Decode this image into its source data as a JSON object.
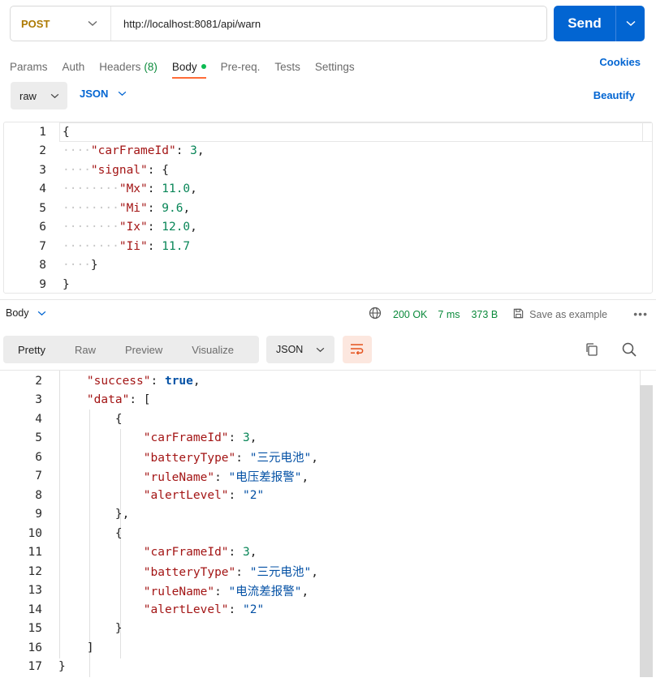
{
  "request": {
    "method": "POST",
    "url": "http://localhost:8081/api/warn",
    "send_label": "Send"
  },
  "request_tabs": [
    {
      "label": "Params"
    },
    {
      "label": "Auth"
    },
    {
      "label": "Headers",
      "count": "(8)"
    },
    {
      "label": "Body",
      "active": true
    },
    {
      "label": "Pre-req."
    },
    {
      "label": "Tests"
    },
    {
      "label": "Settings"
    }
  ],
  "cookies_label": "Cookies",
  "body_mode": "raw",
  "body_language": "JSON",
  "beautify_label": "Beautify",
  "request_body_lines": [
    {
      "n": "1",
      "text": "{"
    },
    {
      "n": "2",
      "text": "\"carFrameId\": 3,"
    },
    {
      "n": "3",
      "text": "\"signal\": {"
    },
    {
      "n": "4",
      "text": "\"Mx\": 11.0,"
    },
    {
      "n": "5",
      "text": "\"Mi\": 9.6,"
    },
    {
      "n": "6",
      "text": "\"Ix\": 12.0,"
    },
    {
      "n": "7",
      "text": "\"Ii\": 11.7"
    },
    {
      "n": "8",
      "text": "}"
    },
    {
      "n": "9",
      "text": "}"
    }
  ],
  "response": {
    "section_label": "Body",
    "status": "200 OK",
    "time": "7 ms",
    "size": "373 B",
    "save_label": "Save as example",
    "more_label": "•••",
    "view_tabs": [
      "Pretty",
      "Raw",
      "Preview",
      "Visualize"
    ],
    "active_view": "Pretty",
    "format": "JSON"
  },
  "response_body_lines": [
    {
      "n": "2",
      "text": "\"success\": true,"
    },
    {
      "n": "3",
      "text": "\"data\": ["
    },
    {
      "n": "4",
      "text": "{"
    },
    {
      "n": "5",
      "text": "\"carFrameId\": 3,"
    },
    {
      "n": "6",
      "text": "\"batteryType\": \"三元电池\","
    },
    {
      "n": "7",
      "text": "\"ruleName\": \"电压差报警\","
    },
    {
      "n": "8",
      "text": "\"alertLevel\": \"2\""
    },
    {
      "n": "9",
      "text": "},"
    },
    {
      "n": "10",
      "text": "{"
    },
    {
      "n": "11",
      "text": "\"carFrameId\": 3,"
    },
    {
      "n": "12",
      "text": "\"batteryType\": \"三元电池\","
    },
    {
      "n": "13",
      "text": "\"ruleName\": \"电流差报警\","
    },
    {
      "n": "14",
      "text": "\"alertLevel\": \"2\""
    },
    {
      "n": "15",
      "text": "}"
    },
    {
      "n": "16",
      "text": "]"
    },
    {
      "n": "17",
      "text": "}"
    }
  ],
  "colors": {
    "accent": "#0265d2",
    "active_tab": "#ff6c37",
    "status_ok": "#0b8a3b",
    "method": "#ad7a03"
  }
}
